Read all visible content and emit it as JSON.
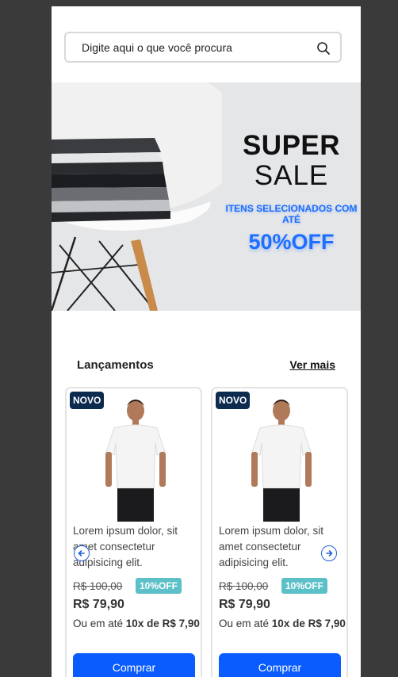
{
  "search": {
    "placeholder": "Digite aqui o que você procura"
  },
  "banner": {
    "line1": "SUPER",
    "line2": "SALE",
    "line3": "ITENS SELECIONADOS COM ATÉ",
    "line4": "50%OFF"
  },
  "section": {
    "title": "Lançamentos",
    "more": "Ver mais"
  },
  "products": [
    {
      "badge": "NOVO",
      "description": "Lorem ipsum dolor, sit amet consectetur adipisicing elit.",
      "old_price": "R$ 100,00",
      "discount": "10%OFF",
      "price": "R$ 79,90",
      "installment_prefix": "Ou em até ",
      "installment_bold": "10x de R$ 7,90",
      "button": "Comprar"
    },
    {
      "badge": "NOVO",
      "description": "Lorem ipsum dolor, sit amet consectetur adipisicing elit.",
      "old_price": "R$ 100,00",
      "discount": "10%OFF",
      "price": "R$ 79,90",
      "installment_prefix": "Ou em até ",
      "installment_bold": "10x de R$ 7,90",
      "button": "Comprar"
    }
  ],
  "colors": {
    "accent": "#0a5cff",
    "badge": "#0d2a4f",
    "discount": "#5bc0c8",
    "sale_text": "#1e6fff"
  },
  "icons": {
    "search": "search-icon",
    "prev": "arrow-left-icon",
    "next": "arrow-right-icon"
  }
}
